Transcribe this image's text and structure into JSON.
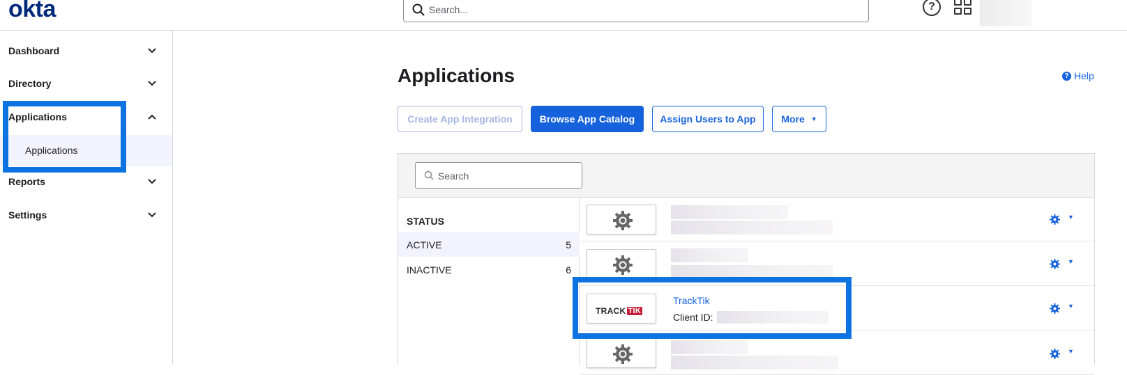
{
  "header": {
    "logo": "okta",
    "search_placeholder": "Search...",
    "help_icon": "help-circle-icon",
    "apps_icon": "grid-icon"
  },
  "sidebar": {
    "items": [
      {
        "label": "Dashboard",
        "expanded": false
      },
      {
        "label": "Directory",
        "expanded": false
      },
      {
        "label": "Applications",
        "expanded": true,
        "children": [
          {
            "label": "Applications",
            "selected": true
          }
        ]
      },
      {
        "label": "Reports",
        "expanded": false
      },
      {
        "label": "Settings",
        "expanded": false
      }
    ]
  },
  "main": {
    "title": "Applications",
    "help_label": "Help",
    "buttons": {
      "create": "Create App Integration",
      "browse": "Browse App Catalog",
      "assign": "Assign Users to App",
      "more": "More"
    },
    "search_placeholder": "Search",
    "status": {
      "heading": "STATUS",
      "rows": [
        {
          "name": "ACTIVE",
          "count": "5"
        },
        {
          "name": "INACTIVE",
          "count": "6"
        }
      ]
    },
    "apps": [
      {
        "name": "",
        "logo": "gear-icon"
      },
      {
        "name": "",
        "logo": "gear-icon"
      },
      {
        "name": "TrackTik",
        "logo": "tracktik-logo",
        "logo_text_1": "TRACK",
        "logo_text_2": "TIK",
        "client_label": "Client ID:"
      },
      {
        "name": "",
        "logo": "gear-icon"
      }
    ]
  },
  "colors": {
    "accent": "#1662dd",
    "highlight": "#0d73e0",
    "brand": "#00297a"
  }
}
